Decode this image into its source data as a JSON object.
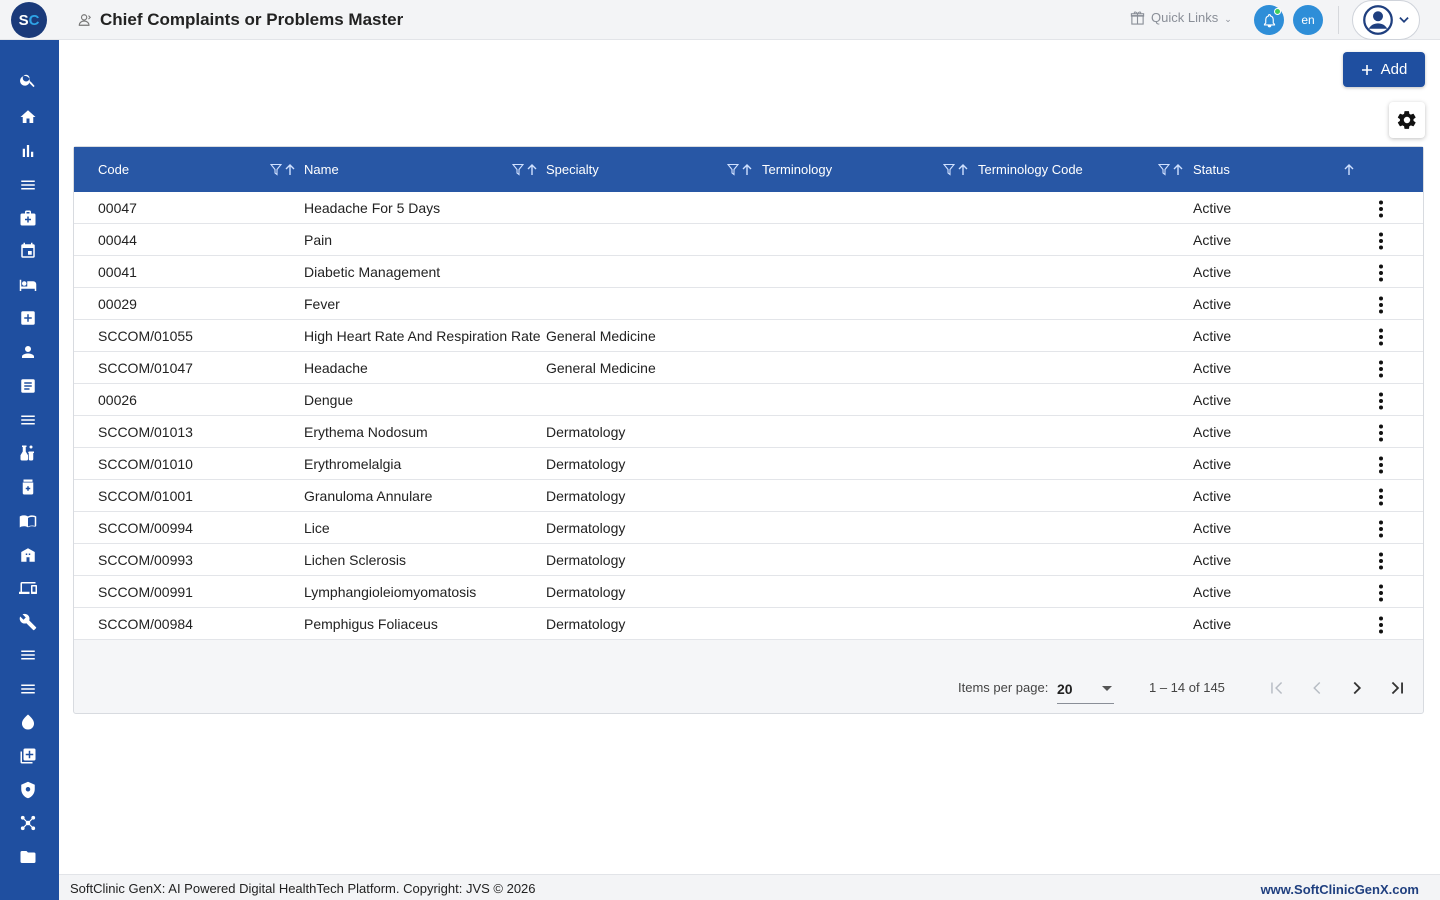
{
  "header": {
    "logo_s": "S",
    "logo_c": "C",
    "title": "Chief Complaints or Problems Master",
    "quick_links": "Quick Links",
    "language": "en"
  },
  "sidebar": {
    "icons": [
      "search-icon",
      "home-icon",
      "bar-chart-icon",
      "menu-icon",
      "medical-bag-icon",
      "calendar-icon",
      "bed-icon",
      "medical-plus-icon",
      "person-icon",
      "list-document-icon",
      "menu-icon",
      "lab-icon",
      "pharmacy-icon",
      "book-icon",
      "building-icon",
      "devices-icon",
      "wrench-icon",
      "menu-icon",
      "menu-icon",
      "blood-drop-icon",
      "add-library-icon",
      "shield-icon",
      "network-icon",
      "folder-icon"
    ]
  },
  "toolbar": {
    "add_label": "Add"
  },
  "table": {
    "columns": [
      "Code",
      "Name",
      "Specialty",
      "Terminology",
      "Terminology Code",
      "Status"
    ],
    "rows": [
      {
        "code": "00047",
        "name": "Headache For 5 Days",
        "specialty": "",
        "terminology": "",
        "terminology_code": "",
        "status": "Active"
      },
      {
        "code": "00044",
        "name": "Pain",
        "specialty": "",
        "terminology": "",
        "terminology_code": "",
        "status": "Active"
      },
      {
        "code": "00041",
        "name": "Diabetic Management",
        "specialty": "",
        "terminology": "",
        "terminology_code": "",
        "status": "Active"
      },
      {
        "code": "00029",
        "name": "Fever",
        "specialty": "",
        "terminology": "",
        "terminology_code": "",
        "status": "Active"
      },
      {
        "code": "SCCOM/01055",
        "name": "High Heart Rate And Respiration Rate",
        "specialty": "General Medicine",
        "terminology": "",
        "terminology_code": "",
        "status": "Active"
      },
      {
        "code": "SCCOM/01047",
        "name": "Headache",
        "specialty": "General Medicine",
        "terminology": "",
        "terminology_code": "",
        "status": "Active"
      },
      {
        "code": "00026",
        "name": "Dengue",
        "specialty": "",
        "terminology": "",
        "terminology_code": "",
        "status": "Active"
      },
      {
        "code": "SCCOM/01013",
        "name": "Erythema Nodosum",
        "specialty": "Dermatology",
        "terminology": "",
        "terminology_code": "",
        "status": "Active"
      },
      {
        "code": "SCCOM/01010",
        "name": "Erythromelalgia",
        "specialty": "Dermatology",
        "terminology": "",
        "terminology_code": "",
        "status": "Active"
      },
      {
        "code": "SCCOM/01001",
        "name": "Granuloma Annulare",
        "specialty": "Dermatology",
        "terminology": "",
        "terminology_code": "",
        "status": "Active"
      },
      {
        "code": "SCCOM/00994",
        "name": "Lice",
        "specialty": "Dermatology",
        "terminology": "",
        "terminology_code": "",
        "status": "Active"
      },
      {
        "code": "SCCOM/00993",
        "name": "Lichen Sclerosis",
        "specialty": "Dermatology",
        "terminology": "",
        "terminology_code": "",
        "status": "Active"
      },
      {
        "code": "SCCOM/00991",
        "name": "Lymphangioleiomyomatosis",
        "specialty": "Dermatology",
        "terminology": "",
        "terminology_code": "",
        "status": "Active"
      },
      {
        "code": "SCCOM/00984",
        "name": "Pemphigus Foliaceus",
        "specialty": "Dermatology",
        "terminology": "",
        "terminology_code": "",
        "status": "Active"
      }
    ]
  },
  "paginator": {
    "items_per_page_label": "Items per page:",
    "items_per_page": "20",
    "range": "1 – 14 of 145"
  },
  "footer": {
    "copyright": "SoftClinic GenX: AI Powered Digital HealthTech Platform. Copyright: JVS © 2026",
    "url": "www.SoftClinicGenX.com"
  },
  "colors": {
    "primary": "#1f4fa0",
    "header_row": "#2857a5",
    "accent": "#2e8ed8",
    "online": "#3fcf5a"
  }
}
